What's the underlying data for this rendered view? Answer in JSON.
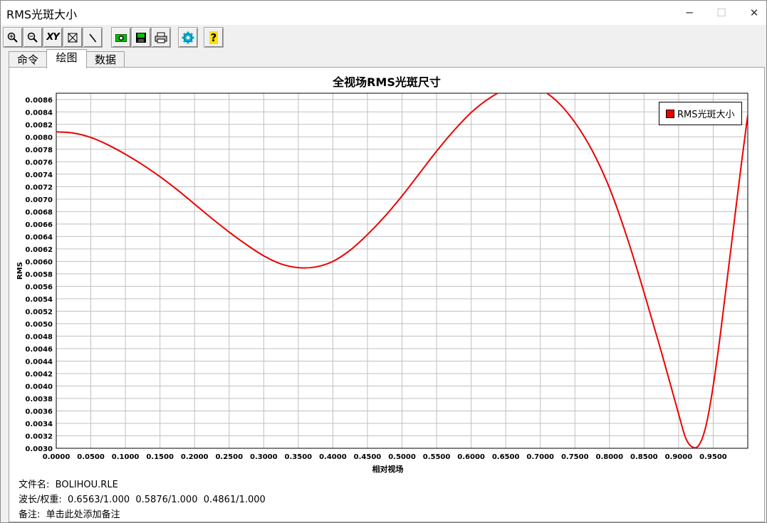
{
  "window": {
    "title": "RMS光斑大小",
    "minimize_icon": "─",
    "maximize_icon": "☐",
    "close_icon": "✕"
  },
  "toolbar": {
    "buttons": [
      "zoom-in-icon",
      "zoom-out-icon",
      "xy-axis-icon",
      "fit-view-icon",
      "pen-icon",
      "camera-icon",
      "save-icon",
      "print-icon",
      "gear-icon",
      "help-icon"
    ],
    "xy_label": "XY",
    "help_label": "?"
  },
  "tabs": [
    {
      "label": "命令"
    },
    {
      "label": "绘图"
    },
    {
      "label": "数据"
    }
  ],
  "active_tab": 1,
  "footer": {
    "file_label": "文件名:",
    "file_value": "BOLIHOU.RLE",
    "wave_label": "波长/权重:",
    "wave_value": "0.6563/1.000  0.5876/1.000  0.4861/1.000",
    "note_label": "备注:",
    "note_value": "单击此处添加备注"
  },
  "chart_data": {
    "type": "line",
    "title": "全视场RMS光斑尺寸",
    "xlabel": "相对视场",
    "ylabel": "RMS",
    "xlim": [
      0,
      1.0
    ],
    "ylim": [
      0.003,
      0.0087
    ],
    "x_ticks": [
      "0.0000",
      "0.0500",
      "0.1000",
      "0.1500",
      "0.2000",
      "0.2500",
      "0.3000",
      "0.3500",
      "0.4000",
      "0.4500",
      "0.5000",
      "0.5500",
      "0.6000",
      "0.6500",
      "0.7000",
      "0.7500",
      "0.8000",
      "0.8500",
      "0.9000",
      "0.9500"
    ],
    "y_ticks": [
      "0.0086",
      "0.0084",
      "0.0082",
      "0.0080",
      "0.0078",
      "0.0076",
      "0.0074",
      "0.0072",
      "0.0070",
      "0.0068",
      "0.0066",
      "0.0064",
      "0.0062",
      "0.0060",
      "0.0058",
      "0.0056",
      "0.0054",
      "0.0052",
      "0.0050",
      "0.0048",
      "0.0046",
      "0.0044",
      "0.0042",
      "0.0040",
      "0.0038",
      "0.0036",
      "0.0034",
      "0.0032",
      "0.0030"
    ],
    "grid": true,
    "legend_position": "top-right",
    "series": [
      {
        "name": "RMS光斑大小",
        "color": "#ee0000",
        "x": [
          0.0,
          0.025,
          0.05,
          0.075,
          0.1,
          0.125,
          0.15,
          0.175,
          0.2,
          0.225,
          0.25,
          0.275,
          0.3,
          0.325,
          0.35,
          0.375,
          0.4,
          0.425,
          0.45,
          0.475,
          0.5,
          0.525,
          0.55,
          0.575,
          0.6,
          0.625,
          0.65,
          0.675,
          0.7,
          0.725,
          0.75,
          0.775,
          0.8,
          0.825,
          0.85,
          0.875,
          0.9,
          0.91,
          0.92,
          0.93,
          0.94,
          0.95,
          0.96,
          0.97,
          0.98,
          0.99,
          1.0
        ],
        "y": [
          0.00808,
          0.00806,
          0.00799,
          0.00787,
          0.00772,
          0.00755,
          0.00736,
          0.00715,
          0.00692,
          0.00669,
          0.00647,
          0.00627,
          0.00609,
          0.00596,
          0.0059,
          0.00591,
          0.006,
          0.00618,
          0.00643,
          0.00672,
          0.00705,
          0.00741,
          0.00777,
          0.0081,
          0.00839,
          0.00861,
          0.00876,
          0.00881,
          0.00876,
          0.00856,
          0.00823,
          0.00778,
          0.00718,
          0.0064,
          0.0055,
          0.00455,
          0.00355,
          0.00317,
          0.00302,
          0.00306,
          0.00338,
          0.004,
          0.0048,
          0.0057,
          0.0066,
          0.0075,
          0.00835
        ]
      }
    ]
  }
}
